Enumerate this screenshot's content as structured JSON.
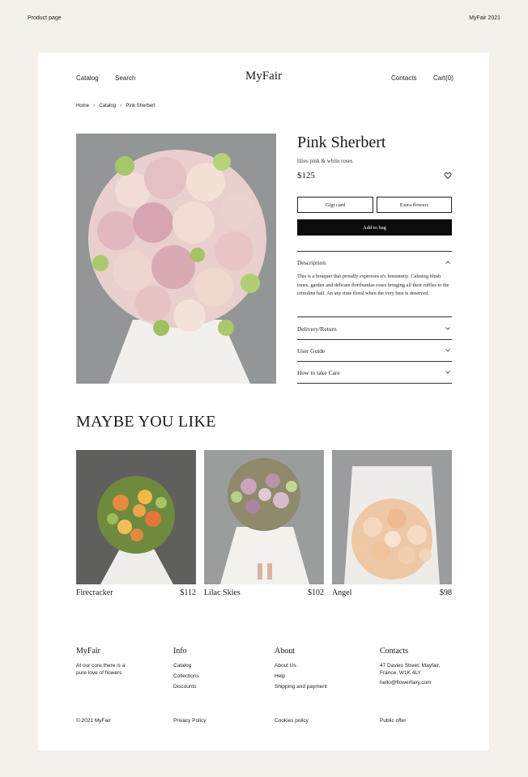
{
  "page": {
    "label_left": "Product page",
    "label_right": "MyFair 2021"
  },
  "header": {
    "logo": "MyFair",
    "nav_left": [
      "Catalog",
      "Search"
    ],
    "contacts": "Contacts",
    "cart": "Cart(0)"
  },
  "breadcrumb": [
    "Home",
    "Catalog",
    "Pink Sherbert"
  ],
  "product": {
    "title": "Pink Sherbert",
    "subtitle": "lilies pink & white roses",
    "price": "$125",
    "option_1": "Gigt card",
    "option_2": "Extra flowers",
    "add_to_bag": "Add to bag",
    "description_title": "Description",
    "description_text": "This is a bouquet that proudly expresses it's femininity. Calming blush tones, garden and delicate floribundas roses bringing all their ruffles to the crinoline ball. An any time floral when the very best is deserved.",
    "accordion": [
      "Delivery/Return",
      "User Guide",
      "How to take Care"
    ]
  },
  "recommend": {
    "title": "MAYBE YOU LIKE",
    "items": [
      {
        "name": "Firecracker",
        "price": "$112"
      },
      {
        "name": "Lilac Skies",
        "price": "$102"
      },
      {
        "name": "Angel",
        "price": "$98"
      }
    ]
  },
  "footer": {
    "brand": {
      "title": "MyFair",
      "text": "At our core there is a pure love of flowers"
    },
    "info": {
      "title": "Info",
      "links": [
        "Catalog",
        "Collections",
        "Discounts"
      ]
    },
    "about": {
      "title": "About",
      "links": [
        "About Us",
        "Help",
        "Shipping and payment"
      ]
    },
    "contacts": {
      "title": "Contacts",
      "address": "47 Davies Street, Mayfair, France, W1K 4LY",
      "email": "hello@flowerfairy.com"
    },
    "bottom": [
      "© 2021 MyFair",
      "Privacy Policy",
      "Cookies policy",
      "Public offer"
    ]
  }
}
